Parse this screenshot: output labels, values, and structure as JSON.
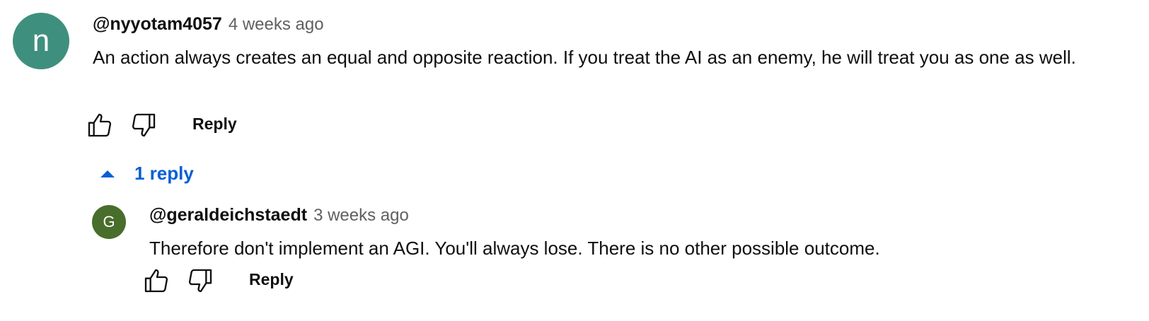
{
  "colors": {
    "accent": "#065fd4",
    "avatar_main_bg": "#3f8f7f",
    "avatar_reply_bg": "#496d2b"
  },
  "comment": {
    "avatar_letter": "n",
    "author": "@nyyotam4057",
    "time": "4 weeks ago",
    "text": "An action always creates an equal and opposite reaction. If you treat the AI as an enemy, he will treat you as one as well.",
    "like_icon": "thumb-up-icon",
    "dislike_icon": "thumb-down-icon",
    "reply_label": "Reply"
  },
  "replies_toggle": {
    "icon": "caret-up-icon",
    "label": "1 reply"
  },
  "reply": {
    "avatar_letter": "G",
    "author": "@geraldeichstaedt",
    "time": "3 weeks ago",
    "text": "Therefore don't implement an AGI. You'll always lose. There is no other possible outcome.",
    "like_icon": "thumb-up-icon",
    "dislike_icon": "thumb-down-icon",
    "reply_label": "Reply"
  }
}
